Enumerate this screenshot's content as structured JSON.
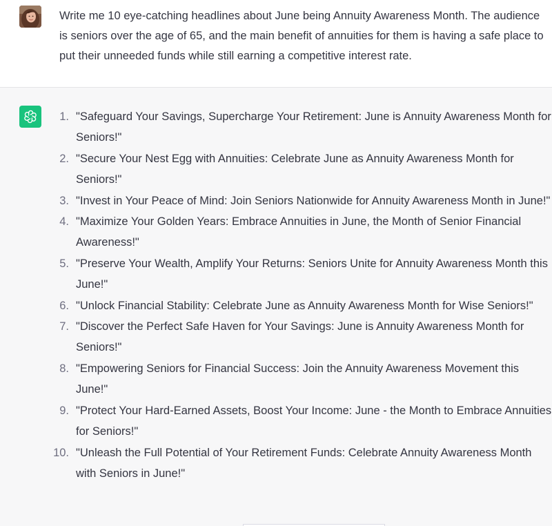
{
  "user_message": {
    "avatar_icon": "user-photo-avatar",
    "text": "Write me 10 eye-catching headlines about June being Annuity Awareness Month. The audience is seniors over the age of 65, and the main benefit of annuities for them is having a safe place to put their unneeded funds while still earning a competitive interest rate."
  },
  "assistant_message": {
    "avatar_icon": "openai-logo-icon",
    "avatar_color": "#19c37d",
    "items": [
      {
        "num": "1.",
        "text": "\"Safeguard Your Savings, Supercharge Your Retirement: June is Annuity Awareness Month for Seniors!\""
      },
      {
        "num": "2.",
        "text": "\"Secure Your Nest Egg with Annuities: Celebrate June as Annuity Awareness Month for Seniors!\""
      },
      {
        "num": "3.",
        "text": "\"Invest in Your Peace of Mind: Join Seniors Nationwide for Annuity Awareness Month in June!\""
      },
      {
        "num": "4.",
        "text": "\"Maximize Your Golden Years: Embrace Annuities in June, the Month of Senior Financial Awareness!\""
      },
      {
        "num": "5.",
        "text": "\"Preserve Your Wealth, Amplify Your Returns: Seniors Unite for Annuity Awareness Month this June!\""
      },
      {
        "num": "6.",
        "text": "\"Unlock Financial Stability: Celebrate June as Annuity Awareness Month for Wise Seniors!\""
      },
      {
        "num": "7.",
        "text": "\"Discover the Perfect Safe Haven for Your Savings: June is Annuity Awareness Month for Seniors!\""
      },
      {
        "num": "8.",
        "text": "\"Empowering Seniors for Financial Success: Join the Annuity Awareness Movement this June!\""
      },
      {
        "num": "9.",
        "text": "\"Protect Your Hard-Earned Assets, Boost Your Income: June - the Month to Embrace Annuities for Seniors!\""
      },
      {
        "num": "10.",
        "text": "\"Unleash the Full Potential of Your Retirement Funds: Celebrate Annuity Awareness Month with Seniors in June!\""
      }
    ]
  }
}
